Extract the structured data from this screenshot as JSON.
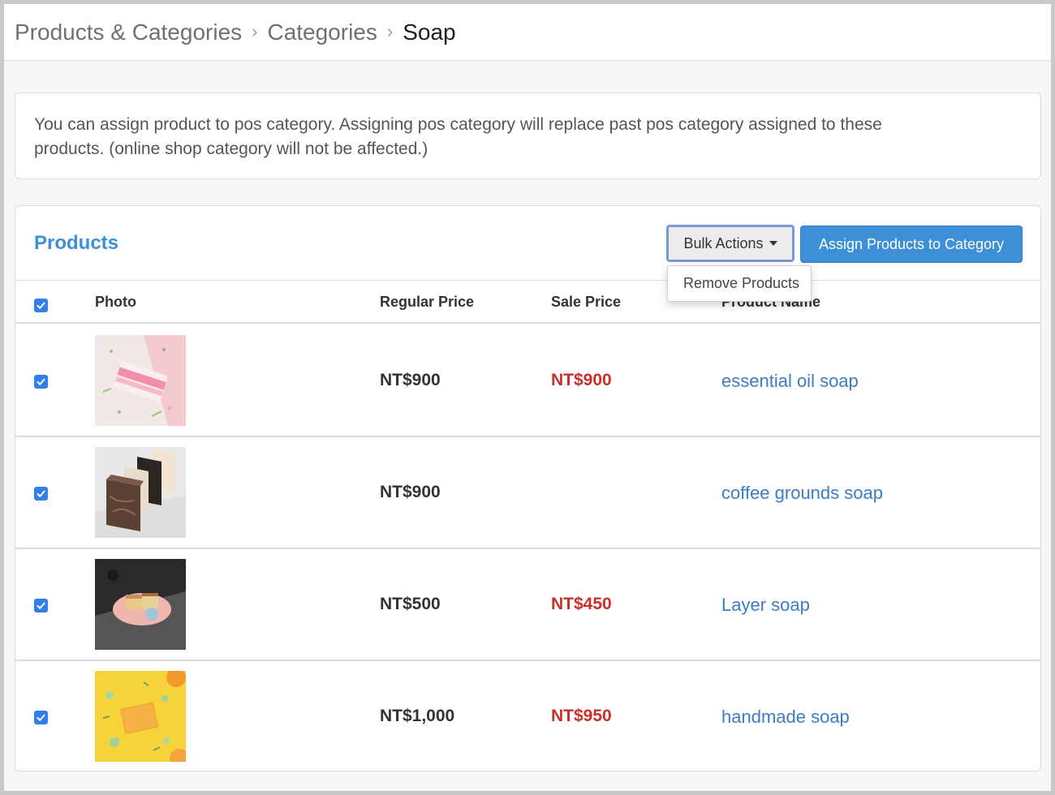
{
  "breadcrumb": {
    "items": [
      "Products & Categories",
      "Categories"
    ],
    "current": "Soap"
  },
  "notice": {
    "line1": "You can assign product to pos category. Assigning pos category will replace past pos category assigned to these",
    "line2": "products. (online shop category will not be affected.)"
  },
  "products_panel": {
    "title": "Products",
    "bulk_actions_label": "Bulk Actions",
    "assign_label": "Assign Products to Category",
    "dropdown": {
      "open": true,
      "items": [
        "Remove Products"
      ]
    }
  },
  "table": {
    "headers": {
      "photo": "Photo",
      "regular_price": "Regular Price",
      "sale_price": "Sale Price",
      "product_name": "Product Name"
    },
    "select_all_checked": true,
    "rows": [
      {
        "checked": true,
        "photo_icon": "pink-soap-photo",
        "regular_price": "NT$900",
        "sale_price": "NT$900",
        "name": "essential oil soap"
      },
      {
        "checked": true,
        "photo_icon": "coffee-soap-photo",
        "regular_price": "NT$900",
        "sale_price": "",
        "name": "coffee grounds soap"
      },
      {
        "checked": true,
        "photo_icon": "layer-soap-photo",
        "regular_price": "NT$500",
        "sale_price": "NT$450",
        "name": "Layer soap"
      },
      {
        "checked": true,
        "photo_icon": "yellow-soap-photo",
        "regular_price": "NT$1,000",
        "sale_price": "NT$950",
        "name": "handmade soap"
      }
    ]
  },
  "colors": {
    "accent": "#3d8fd6",
    "sale_price": "#c9302c",
    "link": "#3b7dc4",
    "checkbox": "#2f7ff0"
  }
}
